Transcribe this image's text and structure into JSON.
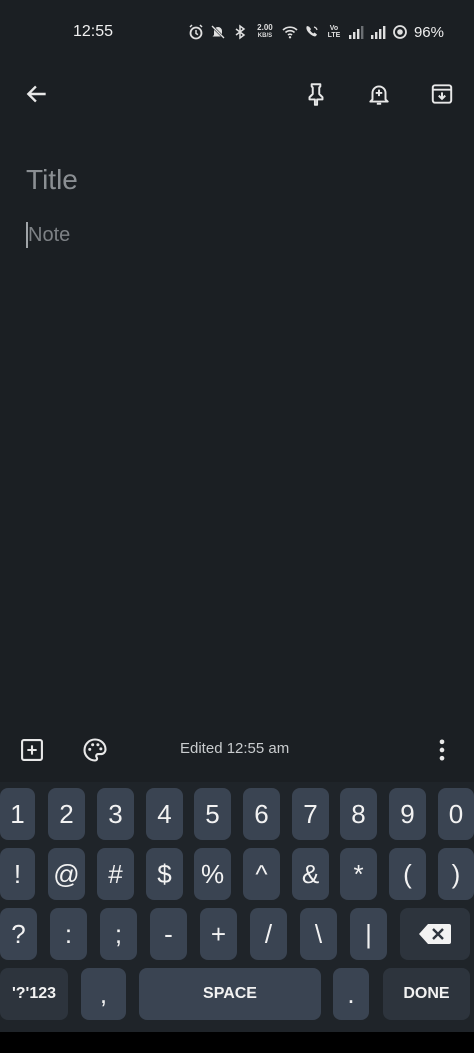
{
  "status_bar": {
    "time": "12:55",
    "net_speed_value": "2.00",
    "net_speed_unit": "KB/S",
    "volte_top": "Vo",
    "volte_bottom": "LTE",
    "battery": "96%"
  },
  "toolbar": {
    "back_icon": "arrow-back-icon",
    "pin_icon": "pin-icon",
    "reminder_icon": "reminder-bell-icon",
    "archive_icon": "archive-icon"
  },
  "editor": {
    "title_placeholder": "Title",
    "note_placeholder": "Note"
  },
  "bottom_bar": {
    "add_icon": "add-box-icon",
    "palette_icon": "palette-icon",
    "edited_text": "Edited 12:55 am",
    "more_icon": "more-vert-icon"
  },
  "keyboard": {
    "row1": [
      "1",
      "2",
      "3",
      "4",
      "5",
      "6",
      "7",
      "8",
      "9",
      "0"
    ],
    "row2": [
      "!",
      "@",
      "#",
      "$",
      "%",
      "^",
      "&",
      "*",
      "(",
      ")"
    ],
    "row3": [
      "?",
      ":",
      ";",
      "-",
      "+",
      "/",
      "\\",
      "|"
    ],
    "row4": {
      "symbols": "'?'123",
      "comma": ",",
      "space": "SPACE",
      "period": ".",
      "done": "DONE"
    },
    "colors": {
      "key": "#3a4452",
      "background": "#1f2429"
    }
  }
}
